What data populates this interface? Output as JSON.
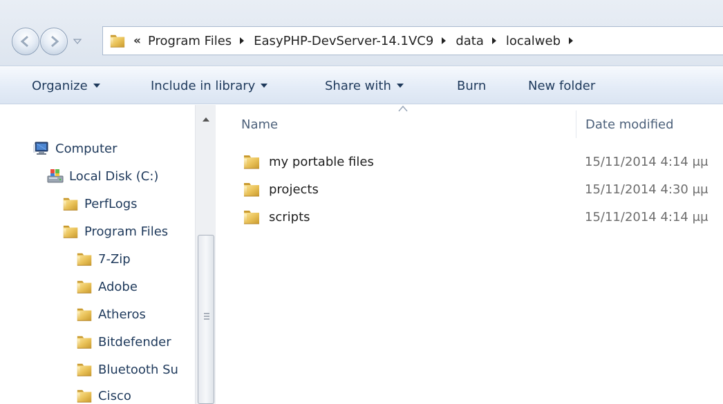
{
  "address_bar": {
    "overflow": "«",
    "breadcrumbs": [
      "Program Files",
      "EasyPHP-DevServer-14.1VC9",
      "data",
      "localweb"
    ]
  },
  "toolbar": {
    "organize": "Organize",
    "include_in_library": "Include in library",
    "share_with": "Share with",
    "burn": "Burn",
    "new_folder": "New folder"
  },
  "nav_tree": {
    "computer": "Computer",
    "local_disk": "Local Disk (C:)",
    "perflogs": "PerfLogs",
    "program_files": "Program Files",
    "sub_items": [
      "7-Zip",
      "Adobe",
      "Atheros",
      "Bitdefender",
      "Bluetooth Su",
      "Cisco"
    ]
  },
  "columns": {
    "name": "Name",
    "date_modified": "Date modified"
  },
  "files": [
    {
      "name": "my portable files",
      "date": "15/11/2014 4:14 μμ"
    },
    {
      "name": "projects",
      "date": "15/11/2014 4:30 μμ"
    },
    {
      "name": "scripts",
      "date": "15/11/2014 4:14 μμ"
    }
  ],
  "icons": {
    "folder": "folder-icon",
    "computer": "computer-icon",
    "drive": "drive-icon",
    "back": "back-arrow-icon",
    "forward": "forward-arrow-icon"
  },
  "colors": {
    "folder_yellow": "#e8c25a",
    "text_blue": "#1e395b",
    "toolbar_bg": "#e4ecf7"
  }
}
